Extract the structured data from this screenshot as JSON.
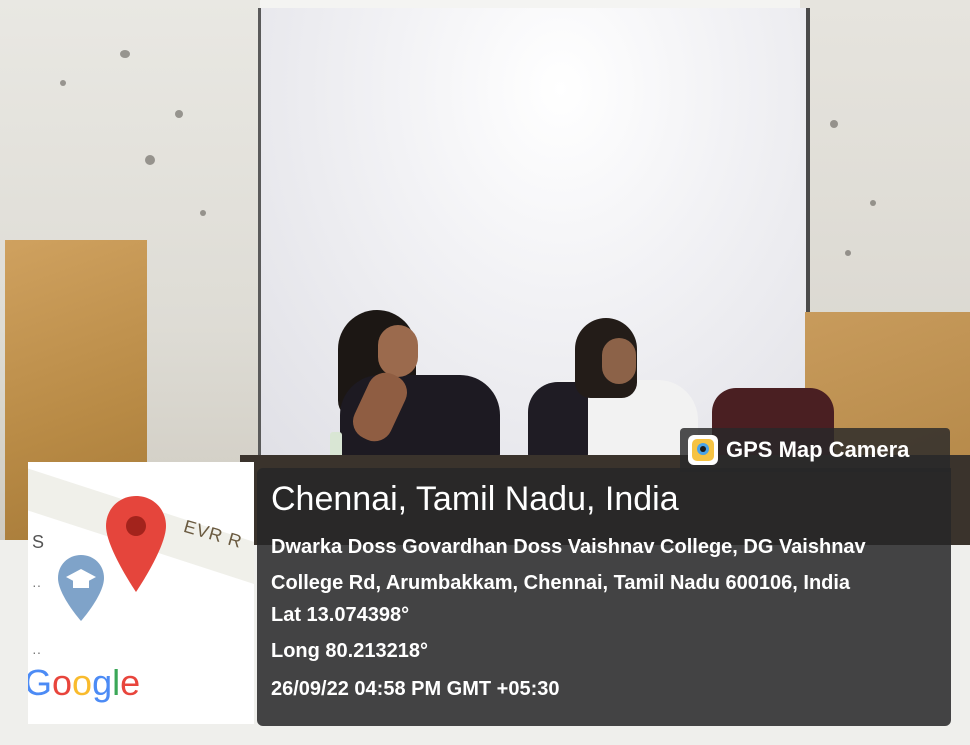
{
  "badge": {
    "label": "GPS Map Camera",
    "icon": "gps-camera-icon"
  },
  "location": {
    "title": "Chennai, Tamil Nadu, India",
    "address_line1": "Dwarka Doss Govardhan Doss Vaishnav College, DG Vaishnav",
    "address_line2": "College Rd, Arumbakkam, Chennai, Tamil Nadu 600106, India",
    "latitude": "Lat 13.074398°",
    "longitude": "Long 80.213218°",
    "timestamp": "26/09/22 04:58 PM GMT +05:30"
  },
  "map": {
    "road_label": "EVR R",
    "edge_letter": "S",
    "google_logo": [
      "G",
      "o",
      "o",
      "g",
      "l",
      "e"
    ],
    "pins": [
      "red-location-pin",
      "blue-education-pin"
    ],
    "colors": {
      "pin_red": "#e5453c",
      "pin_blue": "#7fa3c9"
    }
  },
  "colors": {
    "panel_bg": "#262628",
    "panel_text": "#ffffff"
  }
}
